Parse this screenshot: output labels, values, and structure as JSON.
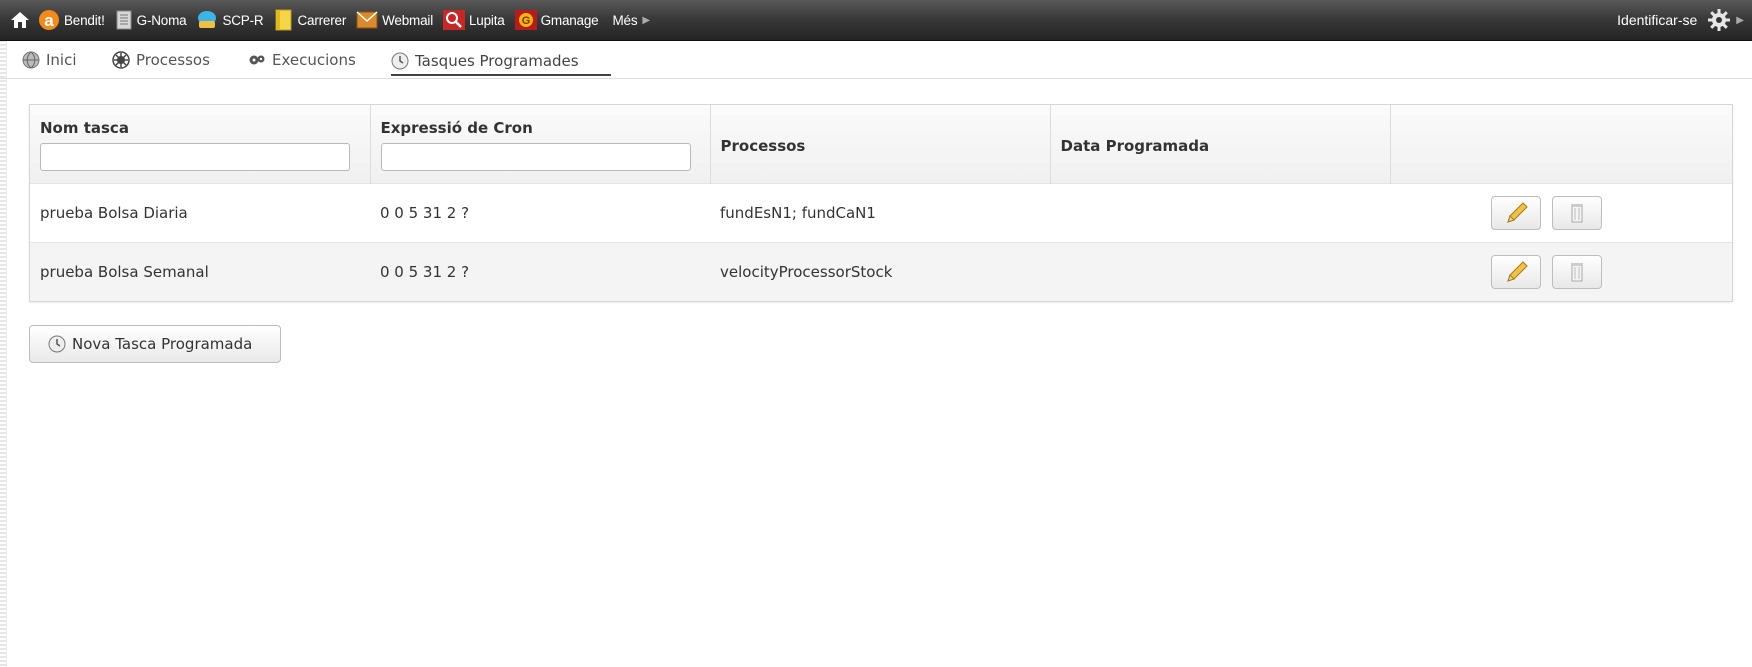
{
  "topbar": {
    "items": [
      {
        "label": "Bendit!"
      },
      {
        "label": "G-Noma"
      },
      {
        "label": "SCP-R"
      },
      {
        "label": "Carrerer"
      },
      {
        "label": "Webmail"
      },
      {
        "label": "Lupita"
      },
      {
        "label": "Gmanage"
      },
      {
        "label": "Més"
      }
    ],
    "login_label": "Identificar-se"
  },
  "nav": {
    "tabs": [
      {
        "label": "Inici"
      },
      {
        "label": "Processos"
      },
      {
        "label": "Execucions"
      },
      {
        "label": "Tasques Programades"
      }
    ],
    "active": "Tasques Programades"
  },
  "table": {
    "columns": [
      "Nom tasca",
      "Expressió de Cron",
      "Processos",
      "Data Programada",
      ""
    ],
    "filters": {
      "nom_tasca": "",
      "cron": ""
    },
    "rows": [
      {
        "name": "prueba Bolsa Diaria",
        "cron": "0 0 5 31 2 ?",
        "processes": "fundEsN1; fundCaN1",
        "date": ""
      },
      {
        "name": "prueba Bolsa Semanal",
        "cron": "0 0 5 31 2 ?",
        "processes": "velocityProcessorStock",
        "date": ""
      }
    ]
  },
  "new_task_button": "Nova Tasca Programada",
  "icons": {
    "home": "home-icon",
    "edit": "pencil-icon",
    "delete": "trash-icon",
    "settings": "gear-icon",
    "clock": "clock-icon"
  },
  "colors": {
    "topbar": "#2e2e2e",
    "accent": "#e8891a"
  }
}
